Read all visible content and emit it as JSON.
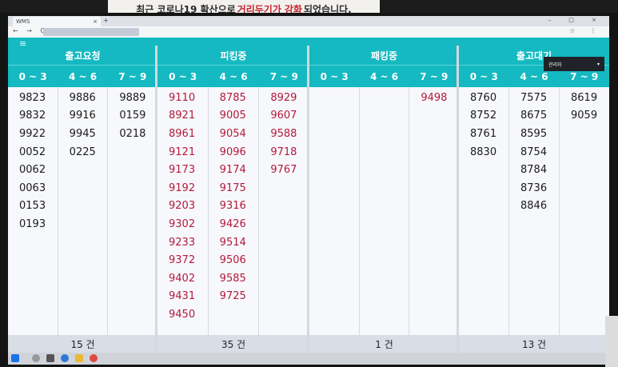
{
  "sign": {
    "part1": "최근 코로나19 확산으로",
    "highlight1": "거리두기가",
    "highlight2": "강화",
    "part2": "되었습니다."
  },
  "browser": {
    "tab_title": "WMS",
    "close_glyph": "×",
    "new_tab_glyph": "+",
    "nav_glyphs": "← → C",
    "tool_glyphs": "☆ ⋮",
    "window_glyphs": "– □ ×"
  },
  "header": {
    "menu_glyph": "≡",
    "user_name": "관리자",
    "caret": "▾"
  },
  "groups": [
    {
      "title": "출고요청",
      "ranges": [
        "0 ~ 3",
        "4 ~ 6",
        "7 ~ 9"
      ],
      "columns": [
        [
          "9823",
          "9832",
          "9922",
          "0052",
          "0062",
          "0063",
          "0153",
          "0193"
        ],
        [
          "9886",
          "9916",
          "9945",
          "0225"
        ],
        [
          "9889",
          "0159",
          "0218"
        ]
      ],
      "total": "15 건"
    },
    {
      "title": "피킹중",
      "ranges": [
        "0 ~ 3",
        "4 ~ 6",
        "7 ~ 9"
      ],
      "columns": [
        [
          "9110",
          "8921",
          "8961",
          "9121",
          "9173",
          "9192",
          "9203",
          "9302",
          "9233",
          "9372",
          "9402",
          "9431",
          "9450"
        ],
        [
          "8785",
          "9005",
          "9054",
          "9096",
          "9174",
          "9175",
          "9316",
          "9426",
          "9514",
          "9506",
          "9585",
          "9725"
        ],
        [
          "8929",
          "9607",
          "9588",
          "9718",
          "9767"
        ]
      ],
      "total": "35 건"
    },
    {
      "title": "패킹중",
      "ranges": [
        "0 ~ 3",
        "4 ~ 6",
        "7 ~ 9"
      ],
      "columns": [
        [],
        [],
        [
          "9498"
        ]
      ],
      "total": "1 건"
    },
    {
      "title": "출고대기",
      "ranges": [
        "0 ~ 3",
        "4 ~ 6",
        "7 ~ 9"
      ],
      "columns": [
        [
          "8760",
          "8752",
          "8761",
          "8830"
        ],
        [
          "7575",
          "8675",
          "8595",
          "8754",
          "8784",
          "8736",
          "8846"
        ],
        [
          "8619",
          "9059"
        ]
      ],
      "total": "13 건"
    }
  ],
  "colors": {
    "teal": "#14b9c1",
    "red_value": "#b3193c",
    "normal_value": "#1a1a1a"
  }
}
